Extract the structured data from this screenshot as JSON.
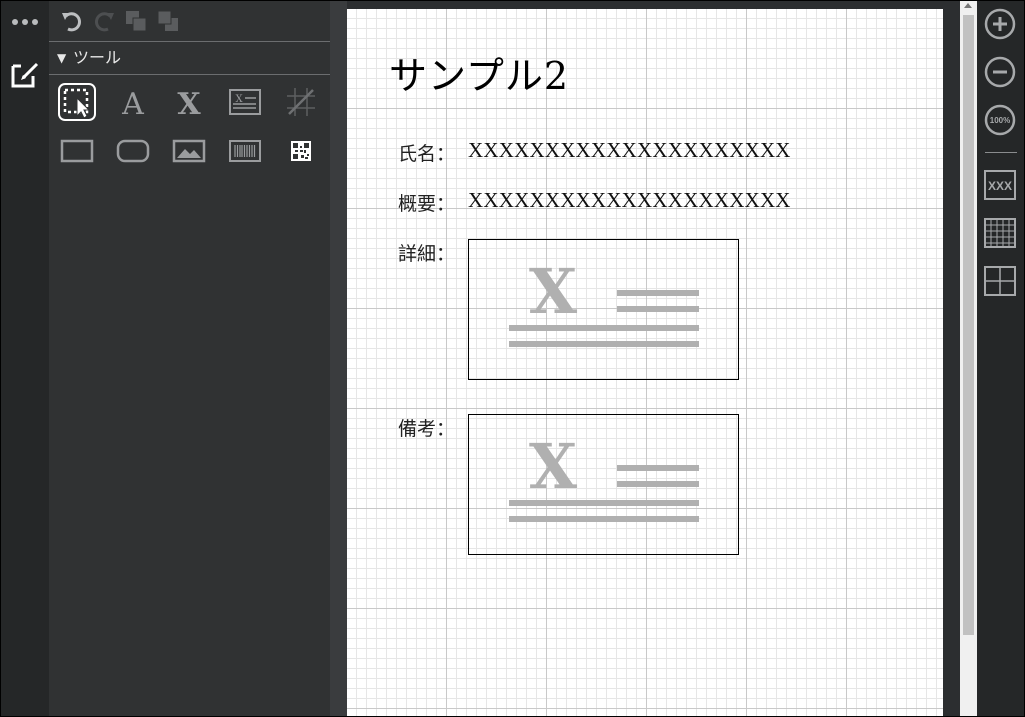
{
  "toolpanel": {
    "section_title": "ツール",
    "section_toggle": "▼"
  },
  "document": {
    "title": "サンプル2",
    "rows": [
      {
        "label": "氏名：",
        "value": "XXXXXXXXXXXXXXXXXXXXX"
      },
      {
        "label": "概要：",
        "value": "XXXXXXXXXXXXXXXXXXXXX"
      },
      {
        "label": "詳細：",
        "value": ""
      },
      {
        "label": "備考：",
        "value": ""
      }
    ]
  },
  "zoom": {
    "reset_label": "100%",
    "text_tool_label": "XXX"
  },
  "colors": {
    "rail": "#252728",
    "panel": "#303233",
    "icon_active": "#ffffff",
    "icon_idle": "#8a8c8e",
    "placeholder_gray": "#b0b0b0"
  }
}
